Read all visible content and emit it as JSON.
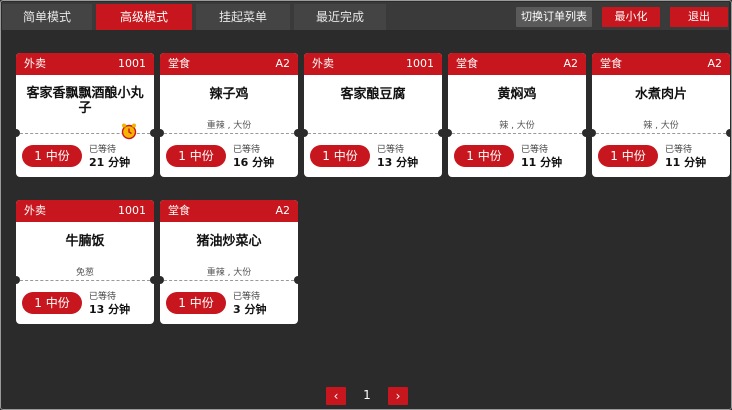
{
  "tabs": [
    {
      "label": "简单模式",
      "active": false
    },
    {
      "label": "高级模式",
      "active": true
    },
    {
      "label": "挂起菜单",
      "active": false
    },
    {
      "label": "最近完成",
      "active": false
    }
  ],
  "toolbar": {
    "switch_list": "切换订单列表",
    "minimize": "最小化",
    "exit": "退出"
  },
  "orders": [
    {
      "type": "外卖",
      "code": "1001",
      "dish": "客家香飘飘酒酿小丸子",
      "spec": "",
      "qty": "1 中份",
      "wait_label": "已等待",
      "wait": "21 分钟",
      "alarm": true
    },
    {
      "type": "堂食",
      "code": "A2",
      "dish": "辣子鸡",
      "spec": "重辣 , 大份",
      "qty": "1 中份",
      "wait_label": "已等待",
      "wait": "16 分钟",
      "alarm": false
    },
    {
      "type": "外卖",
      "code": "1001",
      "dish": "客家酿豆腐",
      "spec": "",
      "qty": "1 中份",
      "wait_label": "已等待",
      "wait": "13 分钟",
      "alarm": false
    },
    {
      "type": "堂食",
      "code": "A2",
      "dish": "黄焖鸡",
      "spec": "辣 , 大份",
      "qty": "1 中份",
      "wait_label": "已等待",
      "wait": "11 分钟",
      "alarm": false
    },
    {
      "type": "堂食",
      "code": "A2",
      "dish": "水煮肉片",
      "spec": "辣 , 大份",
      "qty": "1 中份",
      "wait_label": "已等待",
      "wait": "11 分钟",
      "alarm": false
    },
    {
      "type": "外卖",
      "code": "1001",
      "dish": "牛腩饭",
      "spec": "免葱",
      "qty": "1 中份",
      "wait_label": "已等待",
      "wait": "13 分钟",
      "alarm": false
    },
    {
      "type": "堂食",
      "code": "A2",
      "dish": "猪油炒菜心",
      "spec": "重辣 , 大份",
      "qty": "1 中份",
      "wait_label": "已等待",
      "wait": "3 分钟",
      "alarm": false
    }
  ],
  "pager": {
    "prev": "‹",
    "page": "1",
    "next": "›"
  },
  "colors": {
    "accent": "#c7161d",
    "background": "#2b2b2b"
  }
}
